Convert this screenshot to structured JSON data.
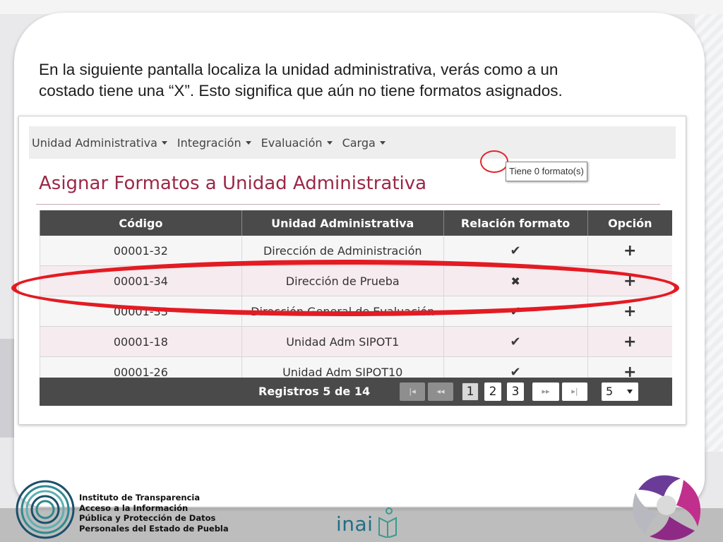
{
  "instruction": {
    "line1": "En la siguiente pantalla localiza la unidad administrativa, verás como a un",
    "line2": "costado tiene una “X”. Esto significa que aún no tiene formatos asignados."
  },
  "navbar": {
    "items": [
      {
        "label": "Unidad Administrativa"
      },
      {
        "label": "Integración"
      },
      {
        "label": "Evaluación"
      },
      {
        "label": "Carga"
      }
    ]
  },
  "page": {
    "title": "Asignar Formatos a Unidad Administrativa"
  },
  "table": {
    "headers": [
      "Código",
      "Unidad Administrativa",
      "Relación formato",
      "Opción"
    ],
    "rows": [
      {
        "codigo": "00001-32",
        "unidad": "Dirección de Administración",
        "relacion": "check"
      },
      {
        "codigo": "00001-34",
        "unidad": "Dirección de Prueba",
        "relacion": "x"
      },
      {
        "codigo": "00001-33",
        "unidad": "Dirección General de Evaluación",
        "relacion": "check"
      },
      {
        "codigo": "00001-18",
        "unidad": "Unidad Adm SIPOT1",
        "relacion": "check"
      },
      {
        "codigo": "00001-26",
        "unidad": "Unidad Adm SIPOT10",
        "relacion": "check"
      }
    ],
    "tooltip": "Tiene 0 formato(s)"
  },
  "pager": {
    "records_label": "Registros 5 de 14",
    "first": "|◂",
    "prev": "◂◂",
    "next": "▸▸",
    "last": "▸|",
    "pages": [
      "1",
      "2",
      "3"
    ],
    "page_size": "5"
  },
  "footer": {
    "org_line1": "Instituto de Transparencia",
    "org_line2": "Acceso a la Información",
    "org_line3": "Pública y Protección de Datos",
    "org_line4": "Personales del Estado de Puebla",
    "inai_logo_text": "inai"
  },
  "colors": {
    "heading": "#9b2847",
    "table_header": "#4a4a4a",
    "highlight": "#e31b23",
    "inai_blue": "#1f6f85"
  }
}
